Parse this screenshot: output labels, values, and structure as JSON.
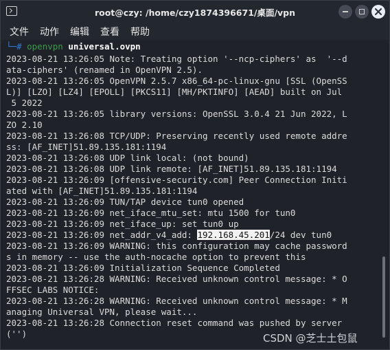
{
  "window": {
    "title": "root@czy: /home/czy1874396671/桌面/vpn"
  },
  "menu": {
    "items": [
      "文件",
      "动作",
      "编辑",
      "查看",
      "帮助"
    ]
  },
  "prompt": {
    "corner": "└─",
    "hash": "#",
    "program": "openvpn",
    "argument": "universal.ovpn"
  },
  "terminal": {
    "lines": [
      "2023-08-21 13:26:05 Note: Treating option '--ncp-ciphers' as  '--d",
      "ata-ciphers' (renamed in OpenVPN 2.5).",
      "2023-08-21 13:26:05 OpenVPN 2.5.7 x86_64-pc-linux-gnu [SSL (OpenSS",
      "L)] [LZO] [LZ4] [EPOLL] [PKCS11] [MH/PKTINFO] [AEAD] built on Jul",
      " 5 2022",
      "2023-08-21 13:26:05 library versions: OpenSSL 3.0.4 21 Jun 2022, L",
      "ZO 2.10",
      "2023-08-21 13:26:08 TCP/UDP: Preserving recently used remote addre",
      "ss: [AF_INET]51.89.135.181:1194",
      "2023-08-21 13:26:08 UDP link local: (not bound)",
      "2023-08-21 13:26:08 UDP link remote: [AF_INET]51.89.135.181:1194",
      "2023-08-21 13:26:09 [offensive-security.com] Peer Connection Initi",
      "ated with [AF_INET]51.89.135.181:1194",
      "2023-08-21 13:26:09 TUN/TAP device tun0 opened",
      "2023-08-21 13:26:09 net_iface_mtu_set: mtu 1500 for tun0",
      "2023-08-21 13:26:09 net_iface_up: set tun0 up",
      "",
      "2023-08-21 13:26:09 WARNING: this configuration may cache password",
      "s in memory -- use the auth-nocache option to prevent this",
      "2023-08-21 13:26:09 Initialization Sequence Completed",
      "2023-08-21 13:26:28 WARNING: Received unknown control message: * O",
      "FFSEC LABS NOTICE:",
      "2023-08-21 13:26:28 WARNING: Received unknown control message: * M",
      "anaging Universal VPN, please wait...",
      "2023-08-21 13:26:28 Connection reset command was pushed by server",
      "('')"
    ],
    "addr_line": {
      "prefix": "2023-08-21 13:26:09 net_addr_v4_add: ",
      "ip": "192.168.45.201",
      "suffix": "/24 dev tun0"
    }
  },
  "watermark": "CSDN @芝士土包鼠"
}
